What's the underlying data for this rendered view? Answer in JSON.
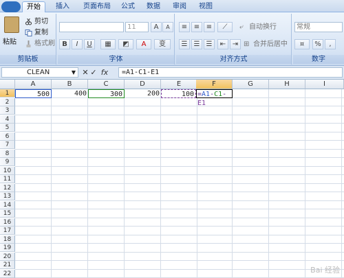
{
  "ribbon": {
    "tabs": [
      "开始",
      "插入",
      "页面布局",
      "公式",
      "数据",
      "审阅",
      "视图"
    ],
    "clipboard": {
      "paste": "粘贴",
      "cut": "剪切",
      "copy": "复制",
      "painter": "格式刷",
      "label": "剪贴板"
    },
    "font": {
      "size": "11",
      "grow": "A",
      "shrink": "A",
      "bold": "B",
      "italic": "I",
      "underline": "U",
      "phonetic": "变",
      "label": "字体"
    },
    "alignment": {
      "wrap": "自动换行",
      "merge": "合并后居中",
      "label": "对齐方式"
    },
    "number": {
      "format": "常规",
      "percent": "%",
      "label": "数字"
    }
  },
  "formula_bar": {
    "name_box": "CLEAN",
    "fx": "fx",
    "formula": "=A1-C1-E1"
  },
  "columns": [
    "A",
    "B",
    "C",
    "D",
    "E",
    "F",
    "G",
    "H",
    "I"
  ],
  "rows": [
    "1",
    "2",
    "3",
    "4",
    "5",
    "6",
    "7",
    "8",
    "9",
    "10",
    "11",
    "12",
    "13",
    "14",
    "15",
    "16",
    "17",
    "18",
    "19",
    "20",
    "21",
    "22"
  ],
  "cells": {
    "A1": "500",
    "B1": "400",
    "C1": "300",
    "D1": "200",
    "E1": "100"
  },
  "formula_parts": {
    "eq": "=",
    "a": "A1",
    "m1": "-",
    "c": "C1",
    "m2": "-",
    "e": "E1"
  },
  "colors": {
    "ref_a": "#2b58c9",
    "ref_c": "#1f8a1f",
    "ref_e": "#7b3a9b"
  }
}
